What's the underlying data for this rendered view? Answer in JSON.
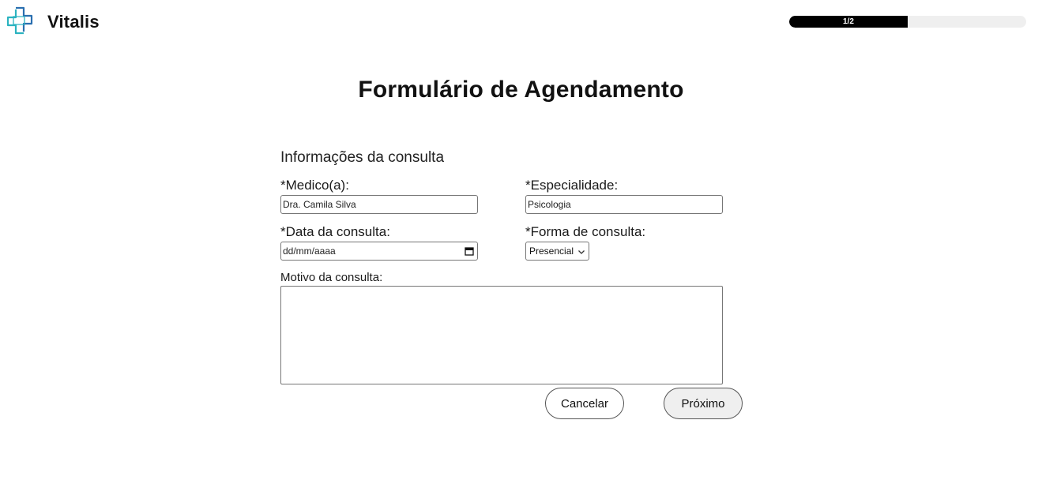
{
  "header": {
    "brand": "Vitalis",
    "progress": {
      "label": "1/2",
      "fraction": 0.5
    }
  },
  "page": {
    "title": "Formulário de Agendamento"
  },
  "form": {
    "section_title": "Informações da consulta",
    "medico": {
      "label": "*Medico(a):",
      "value": "Dra. Camila Silva"
    },
    "especialidade": {
      "label": "*Especialidade:",
      "value": "Psicologia"
    },
    "data": {
      "label": "*Data da consulta:",
      "placeholder": "dd/mm/aaaa"
    },
    "forma": {
      "label": "*Forma de consulta:",
      "selected": "Presencial"
    },
    "motivo": {
      "label": "Motivo da consulta:",
      "value": ""
    }
  },
  "actions": {
    "cancel_label": "Cancelar",
    "next_label": "Próximo"
  },
  "colors": {
    "logo_teal": "#2bb3c0",
    "logo_blue": "#2a6fb0",
    "progress_fill": "#000000",
    "progress_track": "#efefef"
  }
}
